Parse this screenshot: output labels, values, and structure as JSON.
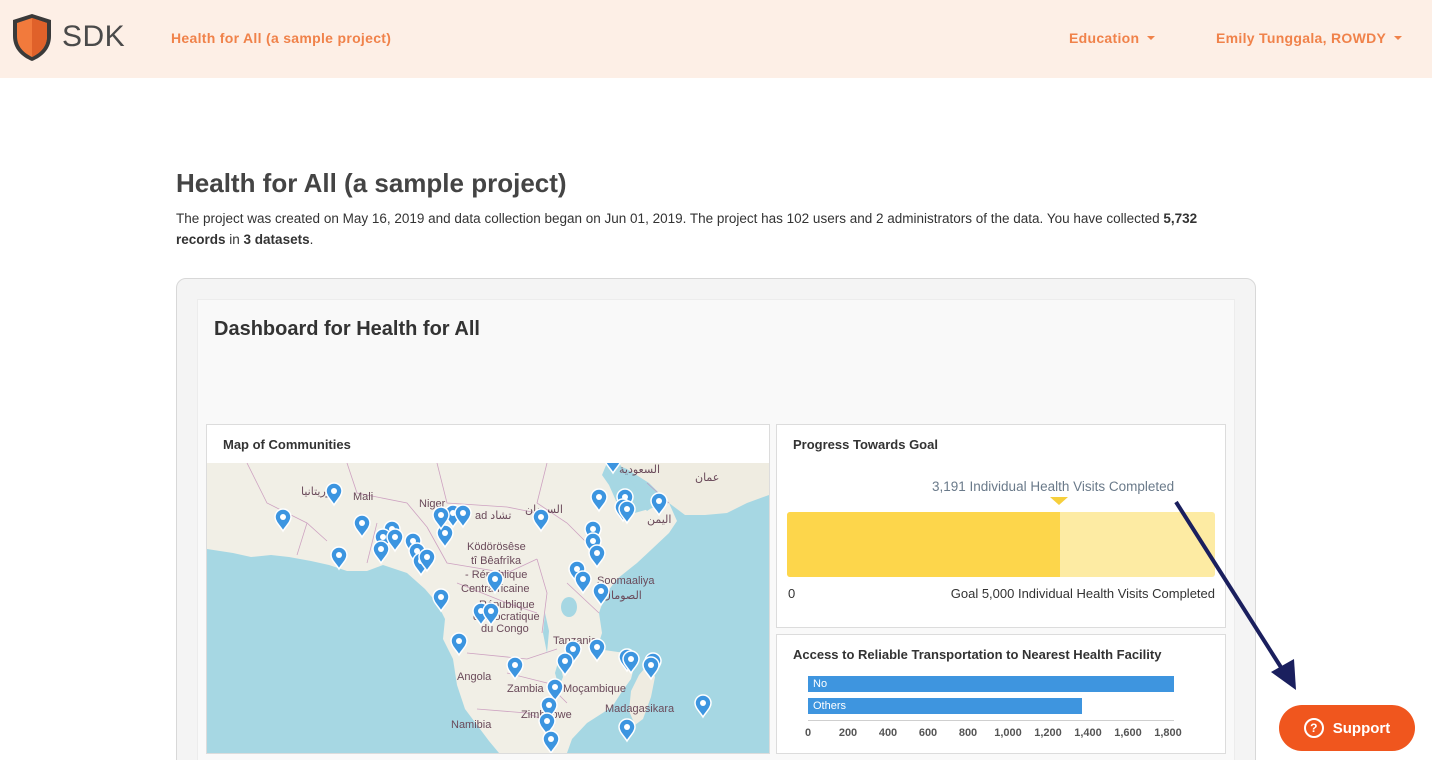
{
  "nav": {
    "logo_text": "SDK",
    "project_link": "Health for All (a sample project)",
    "education_menu": "Education",
    "user_menu": "Emily Tunggala, ROWDY"
  },
  "page": {
    "title": "Health for All (a sample project)",
    "desc_part1": "The project was created on May 16, 2019 and data collection began on Jun 01, 2019. The project has 102 users and 2 administrators of the data. You have collected ",
    "desc_records_count": "5,732 records",
    "desc_part2": " in ",
    "desc_datasets_count": "3 datasets",
    "desc_part3": "."
  },
  "dashboard": {
    "title": "Dashboard for Health for All",
    "map": {
      "title": "Map of Communities",
      "labels": [
        "Mali",
        "Niger",
        "ad تشاد",
        "السودان",
        "السعودية",
        "عمان",
        "اليمن",
        "موريتانيا",
        "Ködörösêse",
        "tî Bêafrîka",
        "- République",
        "Centrafricaine",
        "Soomaaliya",
        "الصومال",
        "République",
        "démocratique",
        "du Congo",
        "Tanzania",
        "Angola",
        "Zambia",
        "Moçambique",
        "Zimbabwe",
        "Namibia",
        "Madagasikara"
      ]
    },
    "progress": {
      "title": "Progress Towards Goal",
      "current_label": "3,191 Individual Health Visits Completed",
      "zero_label": "0",
      "goal_label": "Goal 5,000 Individual Health Visits Completed",
      "value": 3191,
      "goal": 5000
    },
    "transport": {
      "title": "Access to Reliable Transportation to Nearest Health Facility",
      "chart_data": {
        "type": "bar",
        "orientation": "horizontal",
        "categories": [
          "No",
          "Others"
        ],
        "values": [
          1830,
          1370
        ],
        "xlim": [
          0,
          1800
        ],
        "ticks": [
          "0",
          "200",
          "400",
          "600",
          "800",
          "1,000",
          "1,200",
          "1,400",
          "1,600",
          "1,800"
        ],
        "color": "#3e95df"
      }
    }
  },
  "support": {
    "label": "Support",
    "icon": "question-icon",
    "symbol": "?"
  },
  "colors": {
    "nav_bg": "#fdefe6",
    "accent": "#f0824a",
    "support": "#f0561e",
    "progress_fill": "#fdd64b",
    "progress_track": "#fdeba3",
    "bar": "#3e95df"
  }
}
